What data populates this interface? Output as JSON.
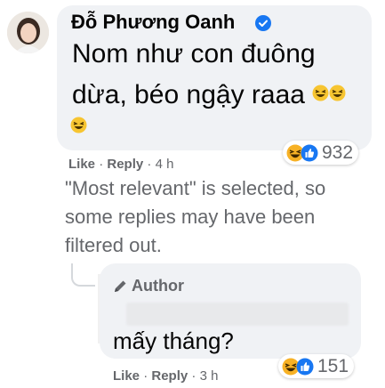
{
  "comment": {
    "author": "Đỗ Phương Oanh",
    "text_line1": "Nom như con đuông",
    "text_line2": "dừa, béo ngậy raaa",
    "reaction_count": "932",
    "actions": {
      "like": "Like",
      "separator": "·",
      "reply": "Reply",
      "time": "4 h"
    }
  },
  "filter_note": "\"Most relevant\" is selected, so some replies may have been filtered out.",
  "reply": {
    "badge": "Author",
    "text": "mấy tháng?",
    "reaction_count": "151",
    "actions": {
      "like": "Like",
      "separator": "·",
      "reply": "Reply",
      "time": "3 h"
    }
  },
  "colors": {
    "bubble": "#f0f2f5",
    "text": "#050505",
    "secondary": "#65676b",
    "verified": "#1877f2",
    "reaction_blue": "#1877f2",
    "reaction_yellow": "#f7b125"
  },
  "icons": [
    "verified-badge-icon",
    "laughing-emoji-icon",
    "haha-reaction-icon",
    "like-reaction-icon",
    "pencil-icon"
  ]
}
